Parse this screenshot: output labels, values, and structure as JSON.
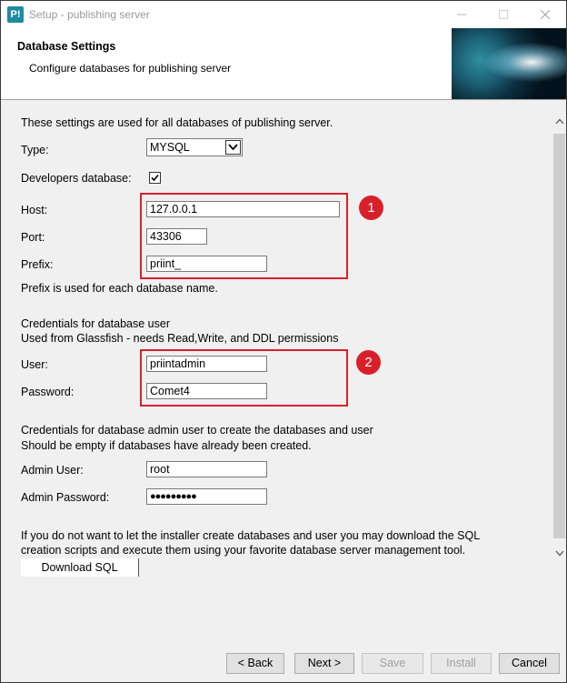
{
  "window": {
    "app_icon_text": "P!",
    "title": "Setup - publishing server",
    "minimize_icon": "minimize-icon",
    "maximize_icon": "maximize-icon",
    "close_icon": "close-icon"
  },
  "header": {
    "title": "Database Settings",
    "subtitle": "Configure databases for publishing server"
  },
  "form": {
    "intro": "These settings are used for all databases of publishing server.",
    "type_label": "Type:",
    "type_value": "MYSQL",
    "dev_db_label": "Developers database:",
    "dev_db_checked": true,
    "host_label": "Host:",
    "host_value": "127.0.0.1",
    "port_label": "Port:",
    "port_value": "43306",
    "prefix_label": "Prefix:",
    "prefix_value": "priint_",
    "prefix_note": "Prefix is used for each database name.",
    "cred_heading": "Credentials for database user",
    "cred_note": "Used from Glassfish - needs Read,Write, and DDL permissions",
    "user_label": "User:",
    "user_value": "priintadmin",
    "password_label": "Password:",
    "password_value": "Comet4",
    "admin_heading": "Credentials for database admin user to create the databases and user",
    "admin_note": "Should be empty if databases have already been created.",
    "admin_user_label": "Admin User:",
    "admin_user_value": "root",
    "admin_password_label": "Admin Password:",
    "admin_password_value": "●●●●●●●●●",
    "sql_note_line1": "If you do not want to let the installer create databases and user you may download the SQL",
    "sql_note_line2": "creation scripts and execute them using your favorite database server management tool.",
    "download_sql_label": "Download SQL"
  },
  "annotations": {
    "badge1": "1",
    "badge2": "2",
    "color": "#d9202a"
  },
  "footer": {
    "back_label": "< Back",
    "next_label": "Next >",
    "save_label": "Save",
    "install_label": "Install",
    "cancel_label": "Cancel"
  }
}
